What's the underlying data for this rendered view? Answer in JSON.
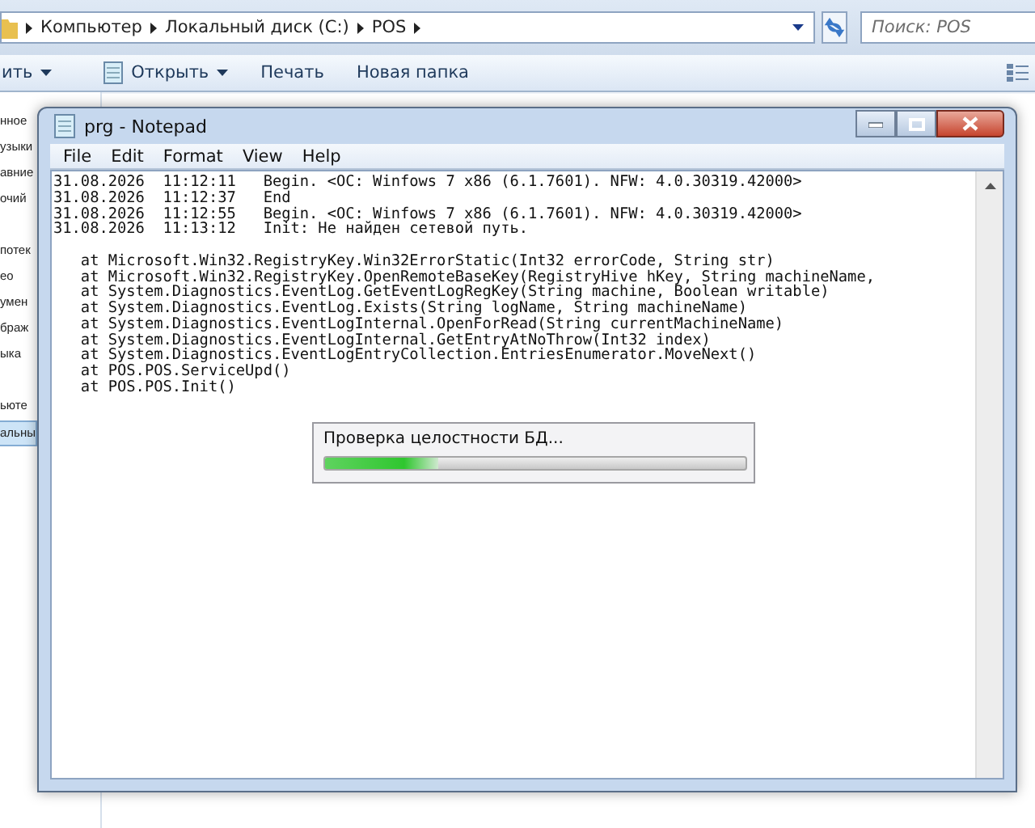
{
  "explorer": {
    "breadcrumbs": [
      "Компьютер",
      "Локальный диск (C:)",
      "POS"
    ],
    "search": {
      "placeholder": "Поиск: POS"
    },
    "toolbar": [
      {
        "label": "ить",
        "kind": "dropdown"
      },
      {
        "label": "Открыть",
        "kind": "opener"
      },
      {
        "label": "Печать",
        "kind": "plain"
      },
      {
        "label": "Новая папка",
        "kind": "plain"
      }
    ],
    "nav_groups": [
      [
        {
          "label": "нное",
          "selected": false
        },
        {
          "label": "узыки",
          "selected": false
        },
        {
          "label": "авние",
          "selected": false
        },
        {
          "label": "очий",
          "selected": false
        }
      ],
      [
        {
          "label": "потек",
          "selected": false
        },
        {
          "label": "ео",
          "selected": false
        },
        {
          "label": "умен",
          "selected": false
        },
        {
          "label": "браж",
          "selected": false
        },
        {
          "label": "ыка",
          "selected": false
        }
      ],
      [
        {
          "label": "ьюте",
          "selected": false
        },
        {
          "label": "альны",
          "selected": true
        }
      ]
    ]
  },
  "notepad": {
    "title": "prg - Notepad",
    "menu": [
      "File",
      "Edit",
      "Format",
      "View",
      "Help"
    ],
    "log_lines": [
      "31.08.2026  11:12:11   Begin. <OC: Winfows 7 x86 (6.1.7601). NFW: 4.0.30319.42000>",
      "31.08.2026  11:12:37   End",
      "31.08.2026  11:12:55   Begin. <OC: Winfows 7 x86 (6.1.7601). NFW: 4.0.30319.42000>",
      "31.08.2026  11:13:12   Init: Не найден сетевой путь."
    ],
    "stack_lines": [
      "   at Microsoft.Win32.RegistryKey.Win32ErrorStatic(Int32 errorCode, String str)",
      "   at Microsoft.Win32.RegistryKey.OpenRemoteBaseKey(RegistryHive hKey, String machineName,",
      "   at System.Diagnostics.EventLog.GetEventLogRegKey(String machine, Boolean writable)",
      "   at System.Diagnostics.EventLog.Exists(String logName, String machineName)",
      "   at System.Diagnostics.EventLogInternal.OpenForRead(String currentMachineName)",
      "   at System.Diagnostics.EventLogInternal.GetEntryAtNoThrow(Int32 index)",
      "   at System.Diagnostics.EventLogEntryCollection.EntriesEnumerator.MoveNext()",
      "   at POS.POS.ServiceUpd()",
      "   at POS.POS.Init()"
    ]
  },
  "progress_dialog": {
    "message": "Проверка целостности БД...",
    "level": 0.27
  }
}
